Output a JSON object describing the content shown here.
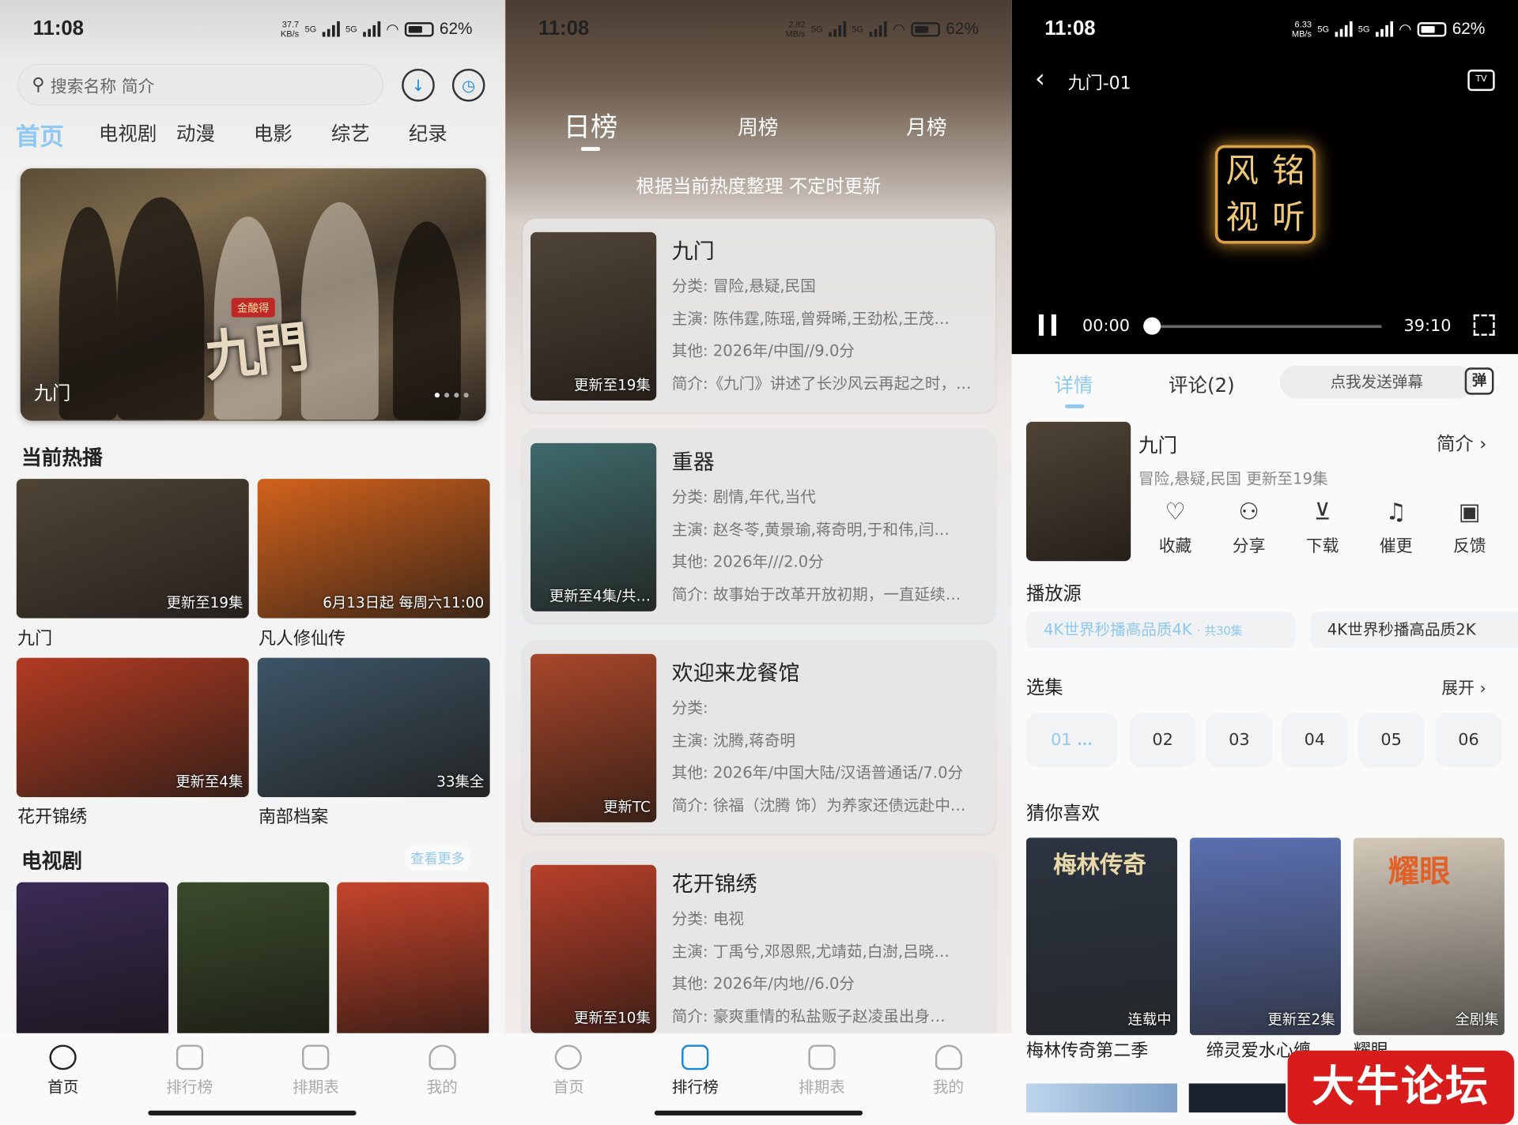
{
  "status_bar": [
    {
      "time": "11:08",
      "speed": "37.7",
      "speed_unit": "KB/s",
      "net1": "5G",
      "net2": "5G",
      "battery": "62%",
      "battery_level": 0.62
    },
    {
      "time": "11:08",
      "speed": "2.82",
      "speed_unit": "MB/s",
      "net1": "5G",
      "net2": "5G",
      "battery": "62%",
      "battery_level": 0.62
    },
    {
      "time": "11:08",
      "speed": "6.33",
      "speed_unit": "MB/s",
      "net1": "5G",
      "net2": "5G",
      "battery": "62%",
      "battery_level": 0.62
    }
  ],
  "home": {
    "search_placeholder": "搜索名称 简介",
    "tabs": [
      "首页",
      "电视剧",
      "动漫",
      "电影",
      "综艺",
      "纪录"
    ],
    "banner": {
      "title": "九门",
      "logo_text": "九門",
      "tag": "金酸得"
    },
    "hot_section": "当前热播",
    "hot": [
      {
        "name": "九门",
        "badge": "更新至19集",
        "color": "#4f4436"
      },
      {
        "name": "凡人修仙传",
        "badge": "6月13日起 每周六11:00",
        "color": "#d2621c"
      },
      {
        "name": "花开锦绣",
        "badge": "更新至4集",
        "color": "#b23b22"
      },
      {
        "name": "南部档案",
        "badge": "33集全",
        "color": "#3c5567"
      }
    ],
    "tv_section": "电视剧",
    "see_more": "查看更多",
    "tv_posters": [
      {
        "color": "#3a2b55"
      },
      {
        "color": "#3a4b2c"
      },
      {
        "color": "#c5452c"
      }
    ]
  },
  "tabbar": [
    "首页",
    "排行榜",
    "排期表",
    "我的"
  ],
  "ranking": {
    "tabs": [
      "日榜",
      "周榜",
      "月榜"
    ],
    "subtitle": "根据当前热度整理 不定时更新",
    "items": [
      {
        "name": "九门",
        "category": "分类: 冒险,悬疑,民国",
        "cast": "主演: 陈伟霆,陈瑶,曾舜晞,王劲松,王茂…",
        "other": "其他: 2026年/中国//9.0分",
        "intro": "简介:《九门》讲述了长沙风云再起之时，…",
        "badge": "更新至19集",
        "color": "#4f4436"
      },
      {
        "name": "重器",
        "category": "分类: 剧情,年代,当代",
        "cast": "主演: 赵冬苓,黄景瑜,蒋奇明,于和伟,闫…",
        "other": "其他: 2026年///2.0分",
        "intro": "简介: 故事始于改革开放初期，一直延续…",
        "badge": "更新至4集/共…",
        "color": "#3f6a6c"
      },
      {
        "name": "欢迎来龙餐馆",
        "category": "分类:",
        "cast": "主演: 沈腾,蒋奇明",
        "other": "其他: 2026年/中国大陆/汉语普通话/7.0分",
        "intro": "简介: 徐福（沈腾 饰）为养家还债远赴中…",
        "badge": "更新TC",
        "color": "#a8472a"
      },
      {
        "name": "花开锦绣",
        "category": "分类: 电视",
        "cast": "主演: 丁禹兮,邓恩熙,尤靖茹,白澍,吕晓…",
        "other": "其他: 2026年/内地//6.0分",
        "intro": "简介: 豪爽重情的私盐贩子赵凌虽出身…",
        "badge": "更新至10集",
        "color": "#b8402a"
      }
    ]
  },
  "detail": {
    "video_title": "九门-01",
    "tv_icon": "TV",
    "logo_chars": [
      "风",
      "铭",
      "视",
      "听"
    ],
    "time_current": "00:00",
    "time_total": "39:10",
    "progress": 0.0,
    "tab_detail": "详情",
    "tab_comments": "评论(2)",
    "danmu_placeholder": "点我发送弹幕",
    "danmu_icon": "弹",
    "name": "九门",
    "intro_link": "简介",
    "meta": "冒险,悬疑,民国 更新至19集",
    "actions": [
      {
        "label": "收藏",
        "icon": "heart-icon",
        "glyph": "♡"
      },
      {
        "label": "分享",
        "icon": "share-icon",
        "glyph": "⚇"
      },
      {
        "label": "下载",
        "icon": "download-icon",
        "glyph": "⊻"
      },
      {
        "label": "催更",
        "icon": "bell-icon",
        "glyph": "♫"
      },
      {
        "label": "反馈",
        "icon": "feedback-icon",
        "glyph": "▣"
      }
    ],
    "source_title": "播放源",
    "sources": [
      "4K世界秒播高品质4K",
      "共30集",
      "4K世界秒播高品质2K"
    ],
    "episodes_title": "选集",
    "expand": "展开",
    "episodes": [
      "01",
      "02",
      "03",
      "04",
      "05",
      "06"
    ],
    "recommend_title": "猜你喜欢",
    "recommend": [
      {
        "name": "梅林传奇第二季",
        "badge": "连载中",
        "overlay": "梅林传奇",
        "color": "#2b3440"
      },
      {
        "name": "缔灵爱水心缠",
        "badge": "更新至2集",
        "overlay": "",
        "color": "#5a6fb0"
      },
      {
        "name": "耀眼",
        "badge": "全剧集",
        "overlay": "耀眼",
        "color": "#d3c9b9"
      }
    ]
  },
  "watermark": "大牛论坛"
}
